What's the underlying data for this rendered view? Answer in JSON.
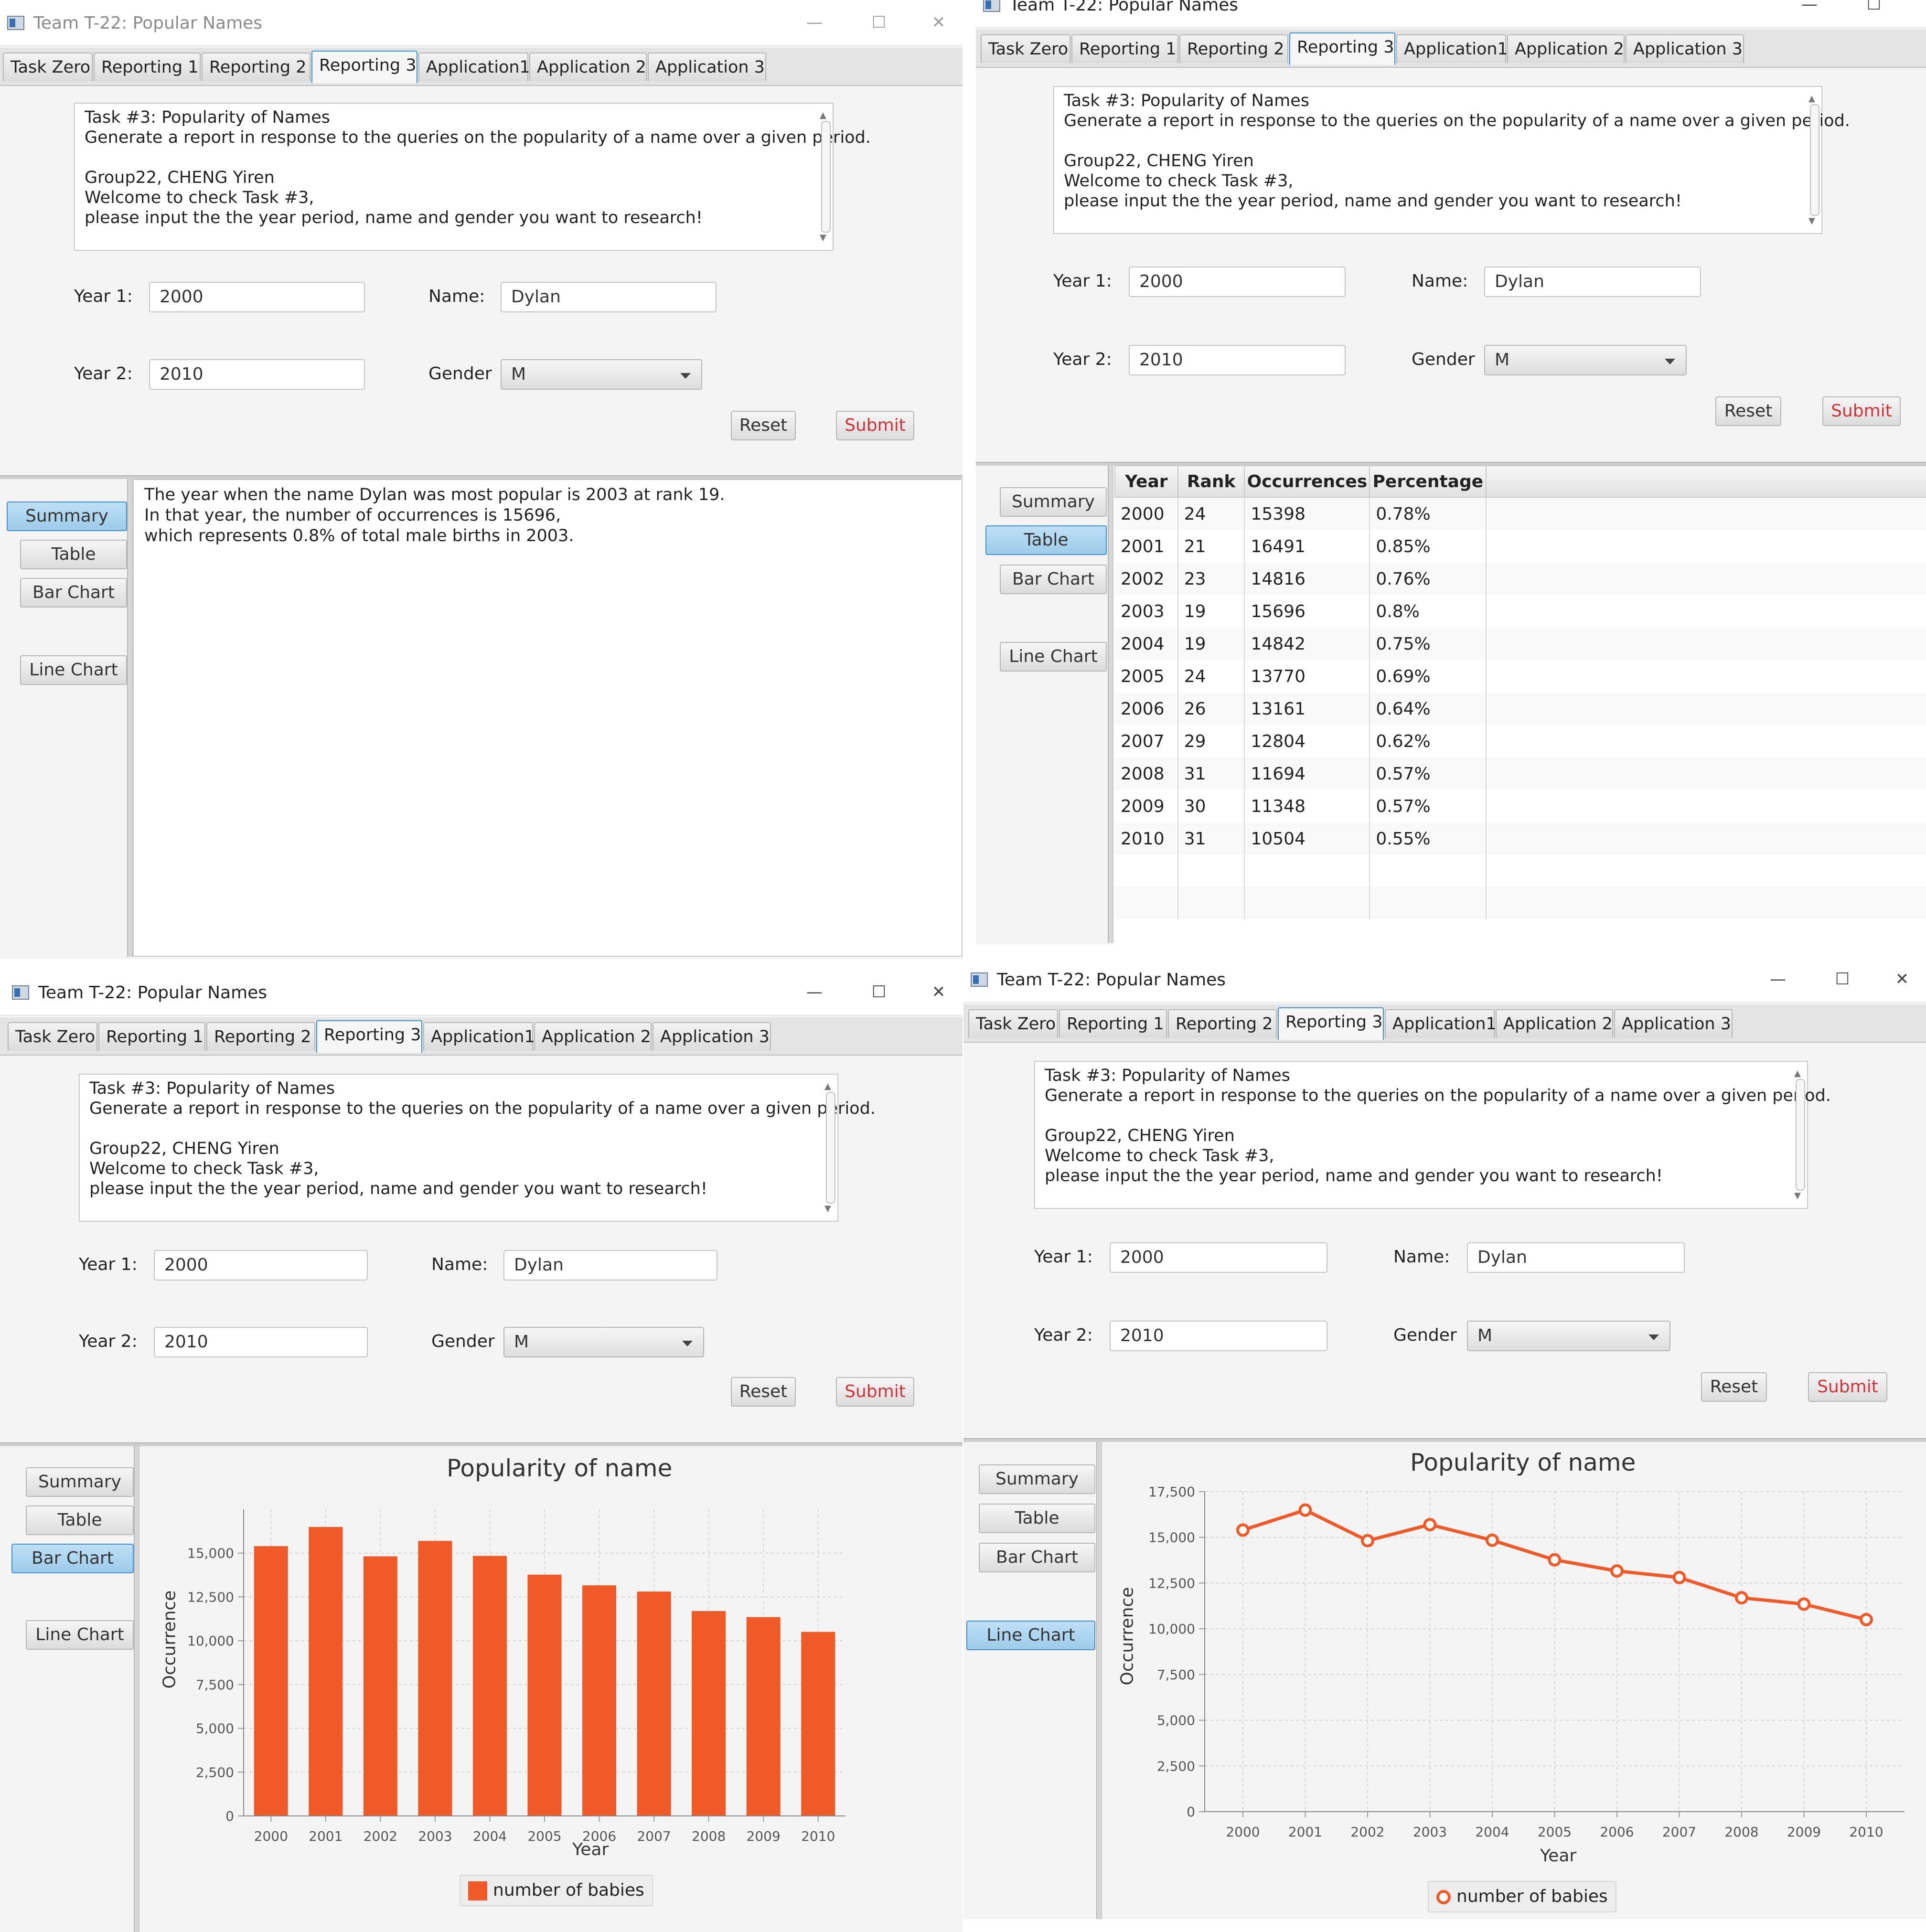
{
  "window_title": "Team T-22: Popular Names",
  "tabs": [
    "Task Zero",
    "Reporting 1",
    "Reporting 2",
    "Reporting 3",
    "Application1",
    "Application 2",
    "Application 3"
  ],
  "selected_tab": "Reporting 3",
  "description": {
    "line1": "Task #3: Popularity of Names",
    "line2": "Generate a report in response to the queries on the popularity of a name over a given period.",
    "line3": "Group22, CHENG Yiren",
    "line4": "Welcome to check Task #3,",
    "line5": "please input the the year period, name and gender you want to research!"
  },
  "form": {
    "year1_label": "Year 1:",
    "year1_value": "2000",
    "year2_label": "Year 2:",
    "year2_value": "2010",
    "name_label": "Name:",
    "name_value": "Dylan",
    "gender_label": "Gender",
    "gender_value": "M",
    "reset_label": "Reset",
    "submit_label": "Submit"
  },
  "side_buttons": {
    "summary": "Summary",
    "table": "Table",
    "bar_chart": "Bar Chart",
    "line_chart": "Line Chart"
  },
  "summary_text": {
    "line1": "The year when the name Dylan was most popular is 2003 at rank 19.",
    "line2": "In that year, the number of occurrences is 15696,",
    "line3": "which represents 0.8% of total male births in 2003."
  },
  "table": {
    "headers": [
      "Year",
      "Rank",
      "Occurrences",
      "Percentage"
    ],
    "rows": [
      [
        "2000",
        "24",
        "15398",
        "0.78%"
      ],
      [
        "2001",
        "21",
        "16491",
        "0.85%"
      ],
      [
        "2002",
        "23",
        "14816",
        "0.76%"
      ],
      [
        "2003",
        "19",
        "15696",
        "0.8%"
      ],
      [
        "2004",
        "19",
        "14842",
        "0.75%"
      ],
      [
        "2005",
        "24",
        "13770",
        "0.69%"
      ],
      [
        "2006",
        "26",
        "13161",
        "0.64%"
      ],
      [
        "2007",
        "29",
        "12804",
        "0.62%"
      ],
      [
        "2008",
        "31",
        "11694",
        "0.57%"
      ],
      [
        "2009",
        "30",
        "11348",
        "0.57%"
      ],
      [
        "2010",
        "31",
        "10504",
        "0.55%"
      ]
    ]
  },
  "colors": {
    "accent": "#f05a28",
    "submit_text": "#d0323a",
    "selected_border": "#3d8fd6",
    "selected_fill": "#a8d3ee"
  },
  "chart_data": [
    {
      "type": "bar",
      "title": "Popularity of name",
      "xlabel": "Year",
      "ylabel": "Occurrence",
      "categories": [
        "2000",
        "2001",
        "2002",
        "2003",
        "2004",
        "2005",
        "2006",
        "2007",
        "2008",
        "2009",
        "2010"
      ],
      "series": [
        {
          "name": "number of babies",
          "values": [
            15398,
            16491,
            14816,
            15696,
            14842,
            13770,
            13161,
            12804,
            11694,
            11348,
            10504
          ]
        }
      ],
      "ylim": [
        0,
        17500
      ],
      "yticks": [
        "0",
        "2,500",
        "5,000",
        "7,500",
        "10,000",
        "12,500",
        "15,000"
      ],
      "grid": true,
      "legend": "bottom"
    },
    {
      "type": "line",
      "title": "Popularity of name",
      "xlabel": "Year",
      "ylabel": "Occurrence",
      "categories": [
        "2000",
        "2001",
        "2002",
        "2003",
        "2004",
        "2005",
        "2006",
        "2007",
        "2008",
        "2009",
        "2010"
      ],
      "series": [
        {
          "name": "number of babies",
          "values": [
            15398,
            16491,
            14816,
            15696,
            14842,
            13770,
            13161,
            12804,
            11694,
            11348,
            10504
          ]
        }
      ],
      "ylim": [
        0,
        17500
      ],
      "yticks": [
        "0",
        "2,500",
        "5,000",
        "7,500",
        "10,000",
        "12,500",
        "15,000",
        "17,500"
      ],
      "grid": true,
      "legend": "bottom"
    }
  ]
}
